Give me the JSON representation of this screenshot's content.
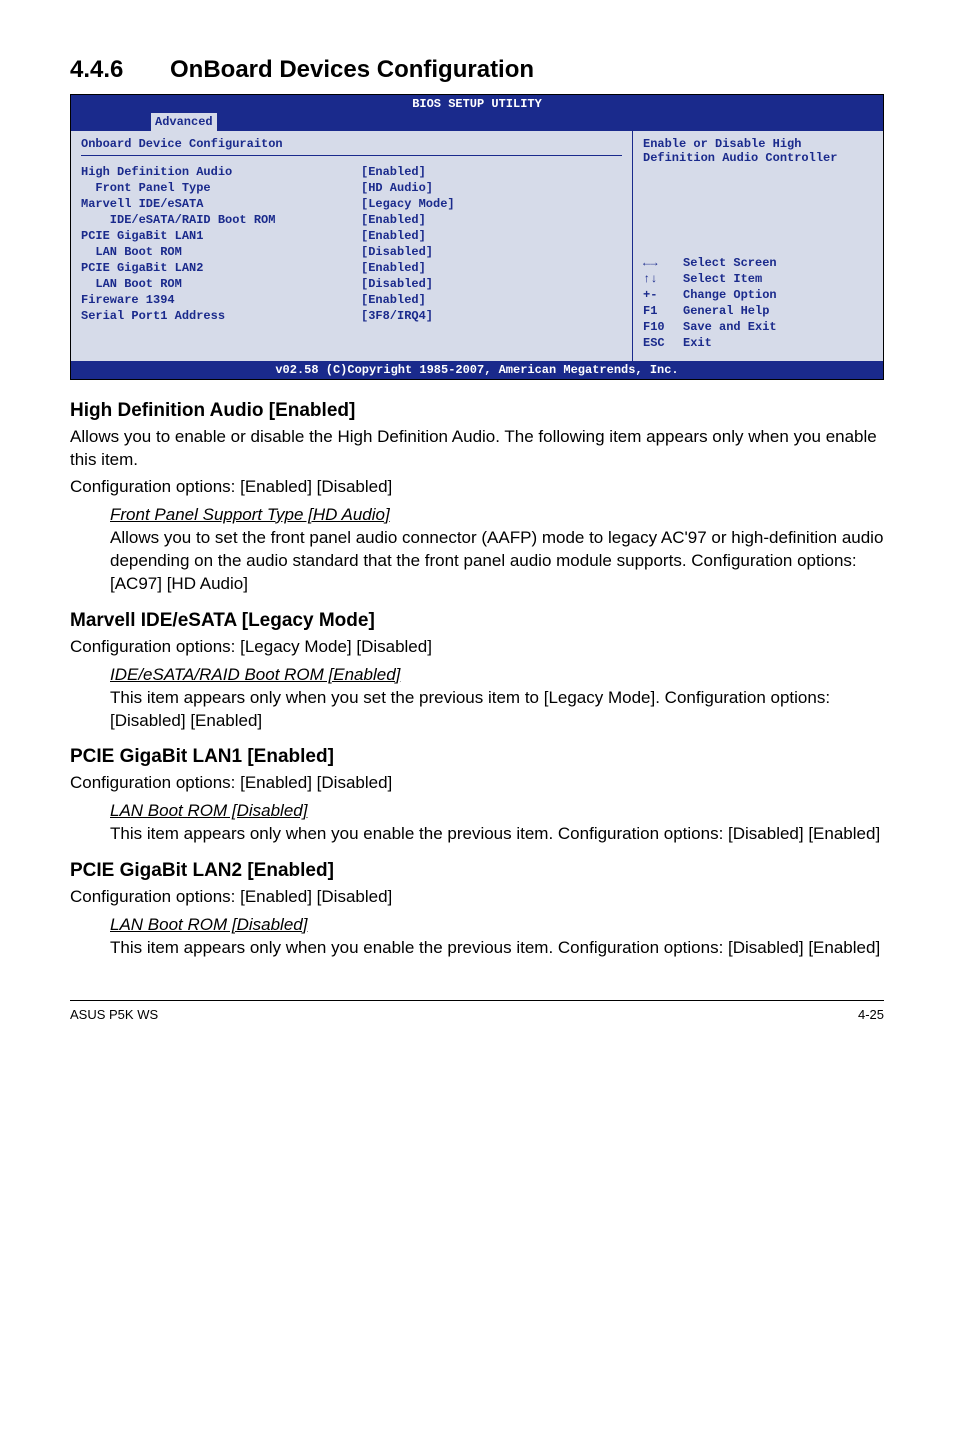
{
  "heading": {
    "number": "4.4.6",
    "title": "OnBoard Devices Configuration"
  },
  "bios": {
    "top_title": "BIOS SETUP UTILITY",
    "tab": "Advanced",
    "panel_title": "Onboard Device Configuraiton",
    "rows": [
      {
        "label": "High Definition Audio",
        "value": "[Enabled]",
        "indent": 0
      },
      {
        "label": "Front Panel Type",
        "value": "[HD Audio]",
        "indent": 1
      },
      {
        "label": "Marvell IDE/eSATA",
        "value": "[Legacy Mode]",
        "indent": 0
      },
      {
        "label": "IDE/eSATA/RAID Boot ROM",
        "value": "[Enabled]",
        "indent": 2
      },
      {
        "label": "PCIE GigaBit LAN1",
        "value": "[Enabled]",
        "indent": 0
      },
      {
        "label": "LAN Boot ROM",
        "value": "[Disabled]",
        "indent": 1
      },
      {
        "label": "PCIE GigaBit LAN2",
        "value": "[Enabled]",
        "indent": 0
      },
      {
        "label": "LAN Boot ROM",
        "value": "[Disabled]",
        "indent": 1
      },
      {
        "label": "Fireware 1394",
        "value": "[Enabled]",
        "indent": 0
      },
      {
        "label": "",
        "value": "",
        "indent": 0
      },
      {
        "label": "Serial Port1 Address",
        "value": "[3F8/IRQ4]",
        "indent": 0
      }
    ],
    "right_help": "Enable or Disable High Definition Audio Controller",
    "nav": [
      {
        "key_icon": "lr",
        "key": "",
        "text": "Select Screen"
      },
      {
        "key_icon": "ud",
        "key": "",
        "text": "Select Item"
      },
      {
        "key_icon": "",
        "key": "+-",
        "text": "Change Option"
      },
      {
        "key_icon": "",
        "key": "F1",
        "text": "General Help"
      },
      {
        "key_icon": "",
        "key": "F10",
        "text": "Save and Exit"
      },
      {
        "key_icon": "",
        "key": "ESC",
        "text": "Exit"
      }
    ],
    "footer": "v02.58 (C)Copyright 1985-2007, American Megatrends, Inc."
  },
  "sections": {
    "hda": {
      "title": "High Definition Audio [Enabled]",
      "p1": "Allows you to enable or disable the High Definition Audio. The following item appears only when you enable this item.",
      "p2": "Configuration options: [Enabled] [Disabled]",
      "sub_title": "Front Panel Support Type [HD Audio]",
      "sub_body": "Allows you to set the front panel audio connector (AAFP) mode to legacy AC'97 or high-definition audio depending on the audio standard that the front panel audio module supports. Configuration options: [AC97] [HD Audio]"
    },
    "marvell": {
      "title": "Marvell IDE/eSATA [Legacy Mode]",
      "p1": "Configuration options: [Legacy Mode] [Disabled]",
      "sub_title": "IDE/eSATA/RAID Boot ROM [Enabled]",
      "sub_body": "This item appears only when you set the previous item to [Legacy Mode]. Configuration options: [Disabled] [Enabled]"
    },
    "lan1": {
      "title": "PCIE GigaBit LAN1 [Enabled]",
      "p1": "Configuration options: [Enabled] [Disabled]",
      "sub_title": "LAN Boot ROM [Disabled]",
      "sub_body": "This item appears only when you enable the previous item. Configuration options: [Disabled] [Enabled]"
    },
    "lan2": {
      "title": "PCIE GigaBit LAN2 [Enabled]",
      "p1": "Configuration options: [Enabled] [Disabled]",
      "sub_title": "LAN Boot ROM [Disabled]",
      "sub_body": "This item appears only when you enable the previous item. Configuration options: [Disabled] [Enabled]"
    }
  },
  "footer": {
    "left": "ASUS P5K WS",
    "right": "4-25"
  }
}
